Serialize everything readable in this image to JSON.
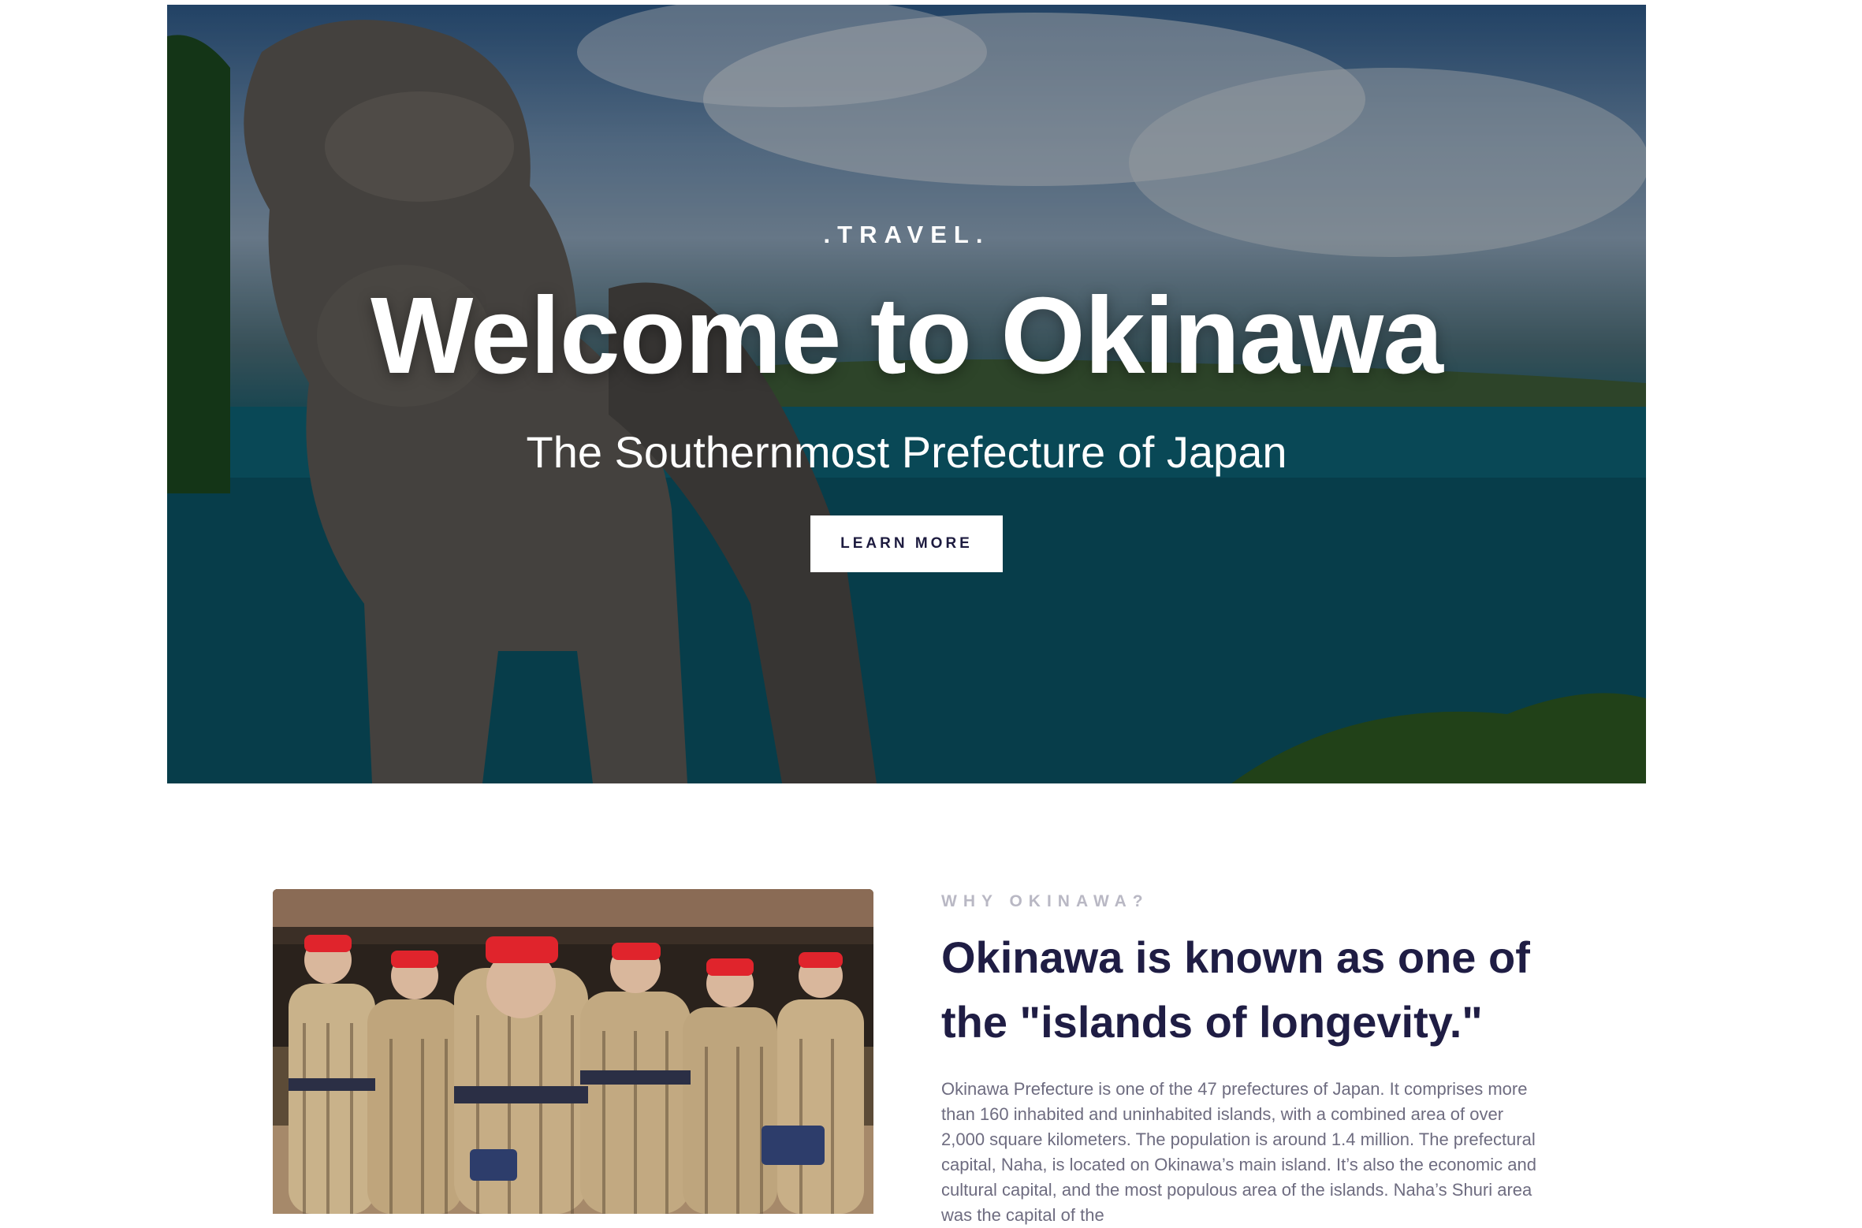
{
  "hero": {
    "eyebrow": ".TRAVEL.",
    "title": "Welcome to Okinawa",
    "subtitle": "The Southernmost Prefecture of Japan",
    "button_label": "LEARN MORE"
  },
  "about": {
    "eyebrow": "WHY OKINAWA?",
    "heading": "Okinawa is known as one of the \"islands of longevity.\"",
    "body": "Okinawa Prefecture is one of the 47 prefectures of Japan. It comprises more than 160 inhabited and uninhabited islands, with a combined area of over 2,000 square kilometers. The population is around 1.4 million. The prefectural capital, Naha, is located on Okinawa’s main island. It’s also the economic and cultural capital, and the most populous area of the islands. Naha’s Shuri area was the capital of the"
  },
  "colors": {
    "heading": "#1f1d44",
    "eyebrow": "#b9b8c4",
    "body": "#6e6c80",
    "button_text": "#1d1b3f"
  },
  "icons": {
    "hero_image": "shisa-lion-statue-and-sea-photo",
    "about_image": "elderly-dancers-photo"
  }
}
